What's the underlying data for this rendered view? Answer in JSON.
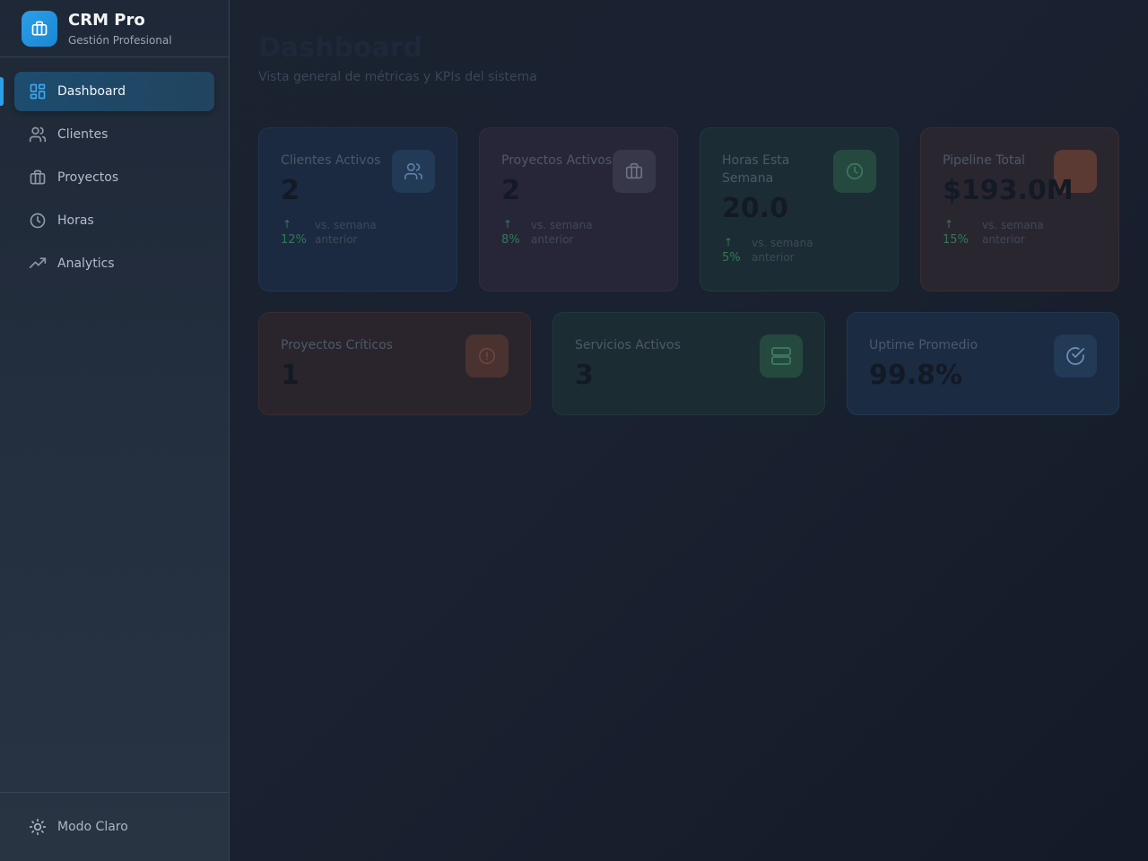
{
  "app": {
    "title": "CRM Pro",
    "subtitle": "Gestión Profesional",
    "accent": "#2aa0ea"
  },
  "sidebar": {
    "items": [
      {
        "label": "Dashboard",
        "icon": "grid-icon",
        "active": true
      },
      {
        "label": "Clientes",
        "icon": "users-icon",
        "active": false
      },
      {
        "label": "Proyectos",
        "icon": "briefcase-icon",
        "active": false
      },
      {
        "label": "Horas",
        "icon": "clock-icon",
        "active": false
      },
      {
        "label": "Analytics",
        "icon": "trending-up-icon",
        "active": false
      }
    ],
    "footer": {
      "label": "Modo Claro",
      "icon": "sun-icon"
    }
  },
  "page": {
    "title": "Dashboard",
    "subtitle": "Vista general de métricas y KPIs del sistema"
  },
  "kpis": [
    {
      "label": "Clientes Activos",
      "value": "2",
      "trend": "12%",
      "trend_text": "vs. semana anterior",
      "icon": "users-icon"
    },
    {
      "label": "Proyectos Activos",
      "value": "2",
      "trend": "8%",
      "trend_text": "vs. semana anterior",
      "icon": "briefcase-icon"
    },
    {
      "label": "Horas Esta Semana",
      "value": "20.0",
      "trend": "5%",
      "trend_text": "vs. semana anterior",
      "icon": "clock-icon"
    },
    {
      "label": "Pipeline Total",
      "value": "$193.0M",
      "trend": "15%",
      "trend_text": "vs. semana anterior",
      "icon": "dollar-icon"
    }
  ],
  "stats": [
    {
      "label": "Proyectos Críticos",
      "value": "1",
      "icon": "alert-circle-icon"
    },
    {
      "label": "Servicios Activos",
      "value": "3",
      "icon": "server-icon"
    },
    {
      "label": "Uptime Promedio",
      "value": "99.8%",
      "icon": "check-circle-icon"
    }
  ]
}
